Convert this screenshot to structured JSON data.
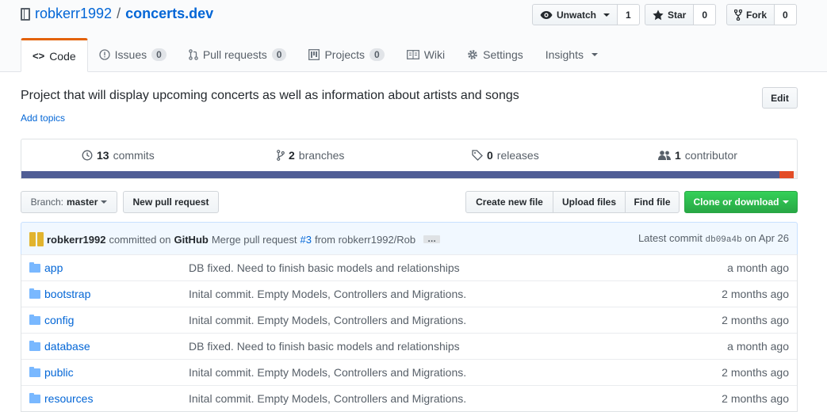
{
  "repo": {
    "owner": "robkerr1992",
    "separator": "/",
    "name": "concerts.dev"
  },
  "actions": {
    "watch": {
      "label": "Unwatch",
      "count": "1"
    },
    "star": {
      "label": "Star",
      "count": "0"
    },
    "fork": {
      "label": "Fork",
      "count": "0"
    }
  },
  "tabs": [
    {
      "label": "Code",
      "icon": "code-icon"
    },
    {
      "label": "Issues",
      "count": "0",
      "icon": "issue-icon"
    },
    {
      "label": "Pull requests",
      "count": "0",
      "icon": "pull-request-icon"
    },
    {
      "label": "Projects",
      "count": "0",
      "icon": "project-icon"
    },
    {
      "label": "Wiki",
      "icon": "book-icon"
    },
    {
      "label": "Settings",
      "icon": "gear-icon"
    },
    {
      "label": "Insights"
    }
  ],
  "description": "Project that will display upcoming concerts as well as information about artists and songs",
  "add_topics": "Add topics",
  "edit_label": "Edit",
  "summary": {
    "commits": {
      "count": "13",
      "label": "commits"
    },
    "branches": {
      "count": "2",
      "label": "branches"
    },
    "releases": {
      "count": "0",
      "label": "releases"
    },
    "contributors": {
      "count": "1",
      "label": "contributor"
    }
  },
  "languages": [
    {
      "color": "#4f5d95",
      "share": 0.978
    },
    {
      "color": "#e34c26",
      "share": 0.018
    },
    {
      "color": "#f0f0f0",
      "share": 0.004
    }
  ],
  "toolbar": {
    "branch_prefix": "Branch:",
    "branch": "master",
    "new_pr": "New pull request",
    "create_file": "Create new file",
    "upload_files": "Upload files",
    "find_file": "Find file",
    "clone": "Clone or download"
  },
  "commit": {
    "author": "robkerr1992",
    "committed_on": "committed on",
    "platform": "GitHub",
    "message_start": "Merge pull request",
    "pr_link": "#3",
    "message_end": "from robkerr1992/Rob",
    "ellipsis": "…",
    "latest_label": "Latest commit",
    "sha": "db09a4b",
    "date": "on Apr 26"
  },
  "files": [
    {
      "name": "app",
      "message": "DB fixed. Need to finish basic models and relationships",
      "age": "a month ago"
    },
    {
      "name": "bootstrap",
      "message": "Inital commit. Empty Models, Controllers and Migrations.",
      "age": "2 months ago"
    },
    {
      "name": "config",
      "message": "Inital commit. Empty Models, Controllers and Migrations.",
      "age": "2 months ago"
    },
    {
      "name": "database",
      "message": "DB fixed. Need to finish basic models and relationships",
      "age": "a month ago"
    },
    {
      "name": "public",
      "message": "Inital commit. Empty Models, Controllers and Migrations.",
      "age": "2 months ago"
    },
    {
      "name": "resources",
      "message": "Inital commit. Empty Models, Controllers and Migrations.",
      "age": "2 months ago"
    }
  ]
}
